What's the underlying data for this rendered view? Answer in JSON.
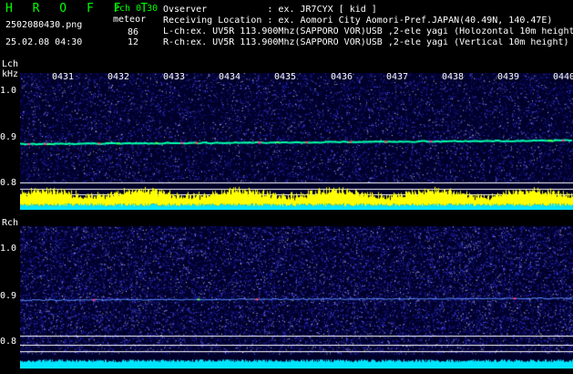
{
  "app": {
    "logo": "H R O F F T",
    "mode": "2ch 0.30",
    "filename": "2502080430.png",
    "datetime": "25.02.08 04:30",
    "meteor_label": "meteor",
    "meteor_counts": [
      "86",
      "12"
    ]
  },
  "info": {
    "observer": "Ovserver           : ex. JR7CYX [ kid ]",
    "location": "Receiving Location : ex. Aomori City Aomori-Pref.JAPAN(40.49N, 140.47E)",
    "lch": "L-ch:ex. UV5R 113.900Mhz(SAPPORO VOR)USB ,2-ele yagi (Holozontal 10m height)",
    "rch": "R-ch:ex. UV5R 113.900Mhz(SAPPORO VOR)USB ,2-ele yagi (Vertical 10m height)"
  },
  "time_ticks": [
    "0431",
    "0432",
    "0433",
    "0434",
    "0435",
    "0436",
    "0437",
    "0438",
    "0439",
    "0440"
  ],
  "left_panel": {
    "channel_label": "Lch",
    "unit_label": "kHz",
    "freq_ticks": [
      "1.0",
      "0.9",
      "0.8"
    ]
  },
  "right_panel": {
    "channel_label": "Rch",
    "freq_ticks": [
      "1.0",
      "0.9",
      "0.8"
    ]
  },
  "colors": {
    "logo": "#00ff00",
    "meteor_text": "#ffffff",
    "spectrogram_bg": "#000033",
    "signal_line": "#00ffaa",
    "level_yellow": "#ffff00",
    "level_cyan": "#00e5ff",
    "level_white_line": "#ffffff"
  },
  "icons": {
    "spectrogram": "waterfall-spectrogram-image"
  }
}
